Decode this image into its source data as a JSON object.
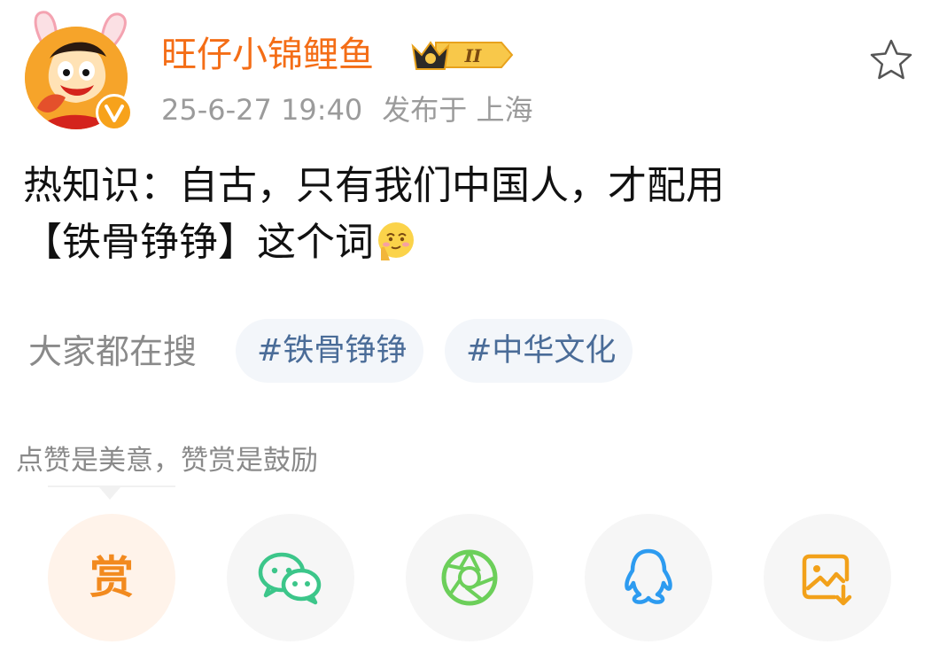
{
  "post": {
    "author": {
      "name": "旺仔小锦鲤鱼",
      "level_badge_text": "II",
      "avatar_icon": "wangzai-avatar-icon",
      "verified_icon": "verified-v-icon"
    },
    "meta": {
      "timestamp": "25-6-27 19:40",
      "location": "发布于 上海"
    },
    "content": {
      "line1": "热知识：自古，只有我们中国人，才配用",
      "line2": "【铁骨铮铮】这个词",
      "emoji": "smirk-face-emoji"
    }
  },
  "search": {
    "label": "大家都在搜",
    "chips": [
      {
        "label": "#铁骨铮铮"
      },
      {
        "label": "#中华文化"
      }
    ]
  },
  "reward": {
    "hint": "点赞是美意，赞赏是鼓励",
    "button_label": "赏"
  },
  "share": {
    "buttons": [
      {
        "icon": "wechat-icon"
      },
      {
        "icon": "moments-icon"
      },
      {
        "icon": "qq-icon"
      },
      {
        "icon": "save-image-icon"
      }
    ]
  },
  "colors": {
    "username": "#f46d16",
    "meta": "#9b9b9b",
    "chip_text": "#4a6c98",
    "chip_bg": "#f3f6fa",
    "wechat": "#3cc68a",
    "moments": "#6ccf5a",
    "qq": "#2d9bf0",
    "reward": "#f28a1f"
  }
}
